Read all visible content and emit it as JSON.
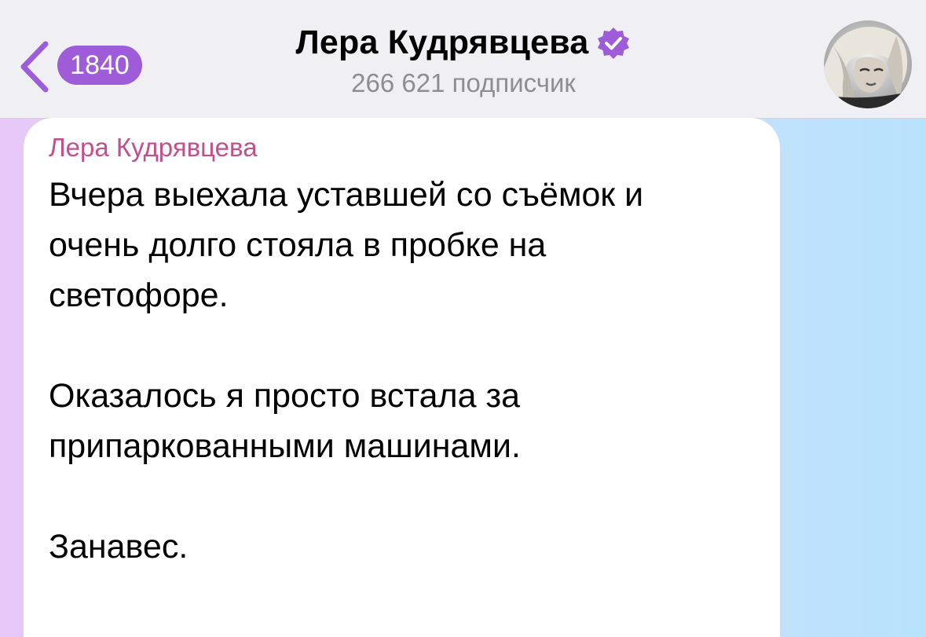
{
  "header": {
    "back_label": "back",
    "unread_count": "1840",
    "channel_name": "Лера Кудрявцева",
    "subscribers": "266 621 подписчик",
    "verified_icon": "verified-badge-icon",
    "avatar_icon": "channel-avatar"
  },
  "message": {
    "author": "Лера Кудрявцева",
    "paragraphs": [
      "Вчера выехала уставшей со съёмок и\nочень долго стояла в пробке на\nсветофоре.",
      "Оказалось я просто встала за\nприпаркованными машинами.",
      "Занавес."
    ]
  },
  "colors": {
    "accent": "#9e5cd9",
    "author_name": "#c2508b",
    "header_bg": "#f0eff3",
    "subtitle": "#8d8d93"
  }
}
